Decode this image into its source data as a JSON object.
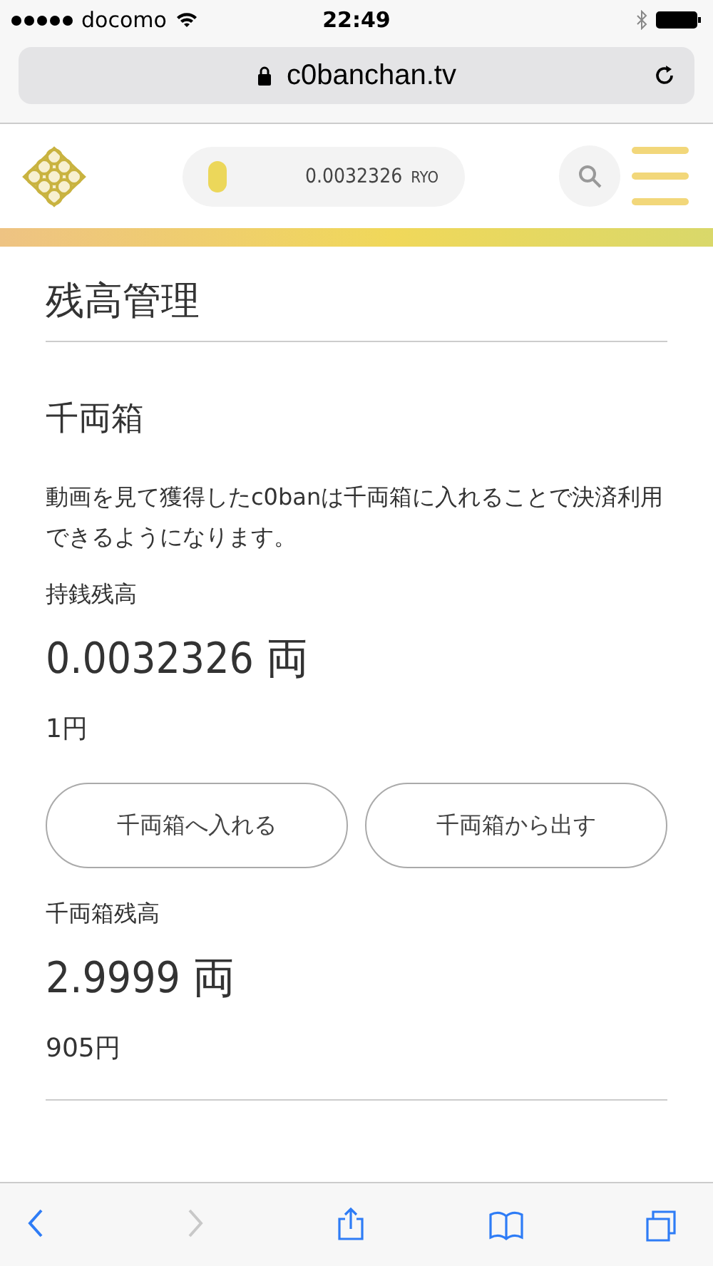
{
  "status_bar": {
    "carrier": "docomo",
    "time": "22:49"
  },
  "address_bar": {
    "url": "c0banchan.tv"
  },
  "header": {
    "balance": "0.0032326",
    "unit": "RYO"
  },
  "page": {
    "title": "残高管理",
    "section_title": "千両箱",
    "description": "動画を見て獲得したc0banは千両箱に入れることで決済利用できるようになります。",
    "wallet": {
      "label": "持銭残高",
      "amount": "0.0032326 両",
      "yen": "1円"
    },
    "buttons": [
      "千両箱へ入れる",
      "千両箱から出す"
    ],
    "box": {
      "label": "千両箱残高",
      "amount": "2.9999 両",
      "yen": "905円"
    }
  },
  "toolbar": [
    {
      "kind": "back",
      "disabled": false
    },
    {
      "kind": "forward",
      "disabled": true
    },
    {
      "kind": "share",
      "disabled": false
    },
    {
      "kind": "bookmarks",
      "disabled": false
    },
    {
      "kind": "tabs",
      "disabled": false
    }
  ]
}
